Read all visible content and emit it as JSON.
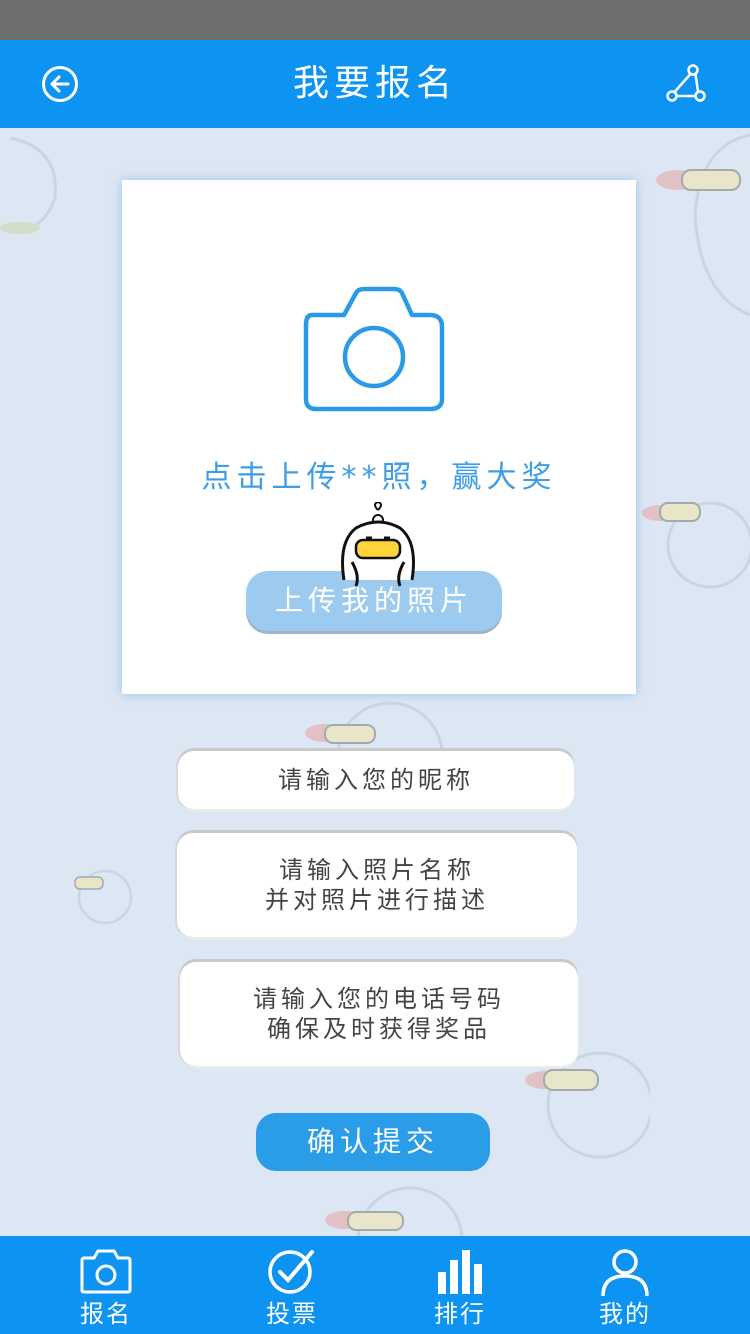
{
  "header": {
    "title": "我要报名",
    "back_icon": "back-arrow-icon",
    "share_icon": "share-icon"
  },
  "upload": {
    "hint": "点击上传**照，赢大奖",
    "button_label": "上传我的照片",
    "camera_icon": "camera-icon"
  },
  "form": {
    "nickname_placeholder": "请输入您的昵称",
    "photo_desc_line1": "请输入照片名称",
    "photo_desc_line2": "并对照片进行描述",
    "phone_line1": "请输入您的电话号码",
    "phone_line2": "确保及时获得奖品",
    "submit_label": "确认提交"
  },
  "tabbar": {
    "items": [
      {
        "label": "报名",
        "icon": "camera-icon"
      },
      {
        "label": "投票",
        "icon": "check-circle-icon"
      },
      {
        "label": "排行",
        "icon": "bar-chart-icon"
      },
      {
        "label": "我的",
        "icon": "user-icon"
      }
    ]
  },
  "colors": {
    "primary": "#0d93f2",
    "background": "#dce7f3",
    "hint_text": "#3f9de8",
    "upload_button": "#9ccbef",
    "submit_button": "#2b9ce8"
  }
}
